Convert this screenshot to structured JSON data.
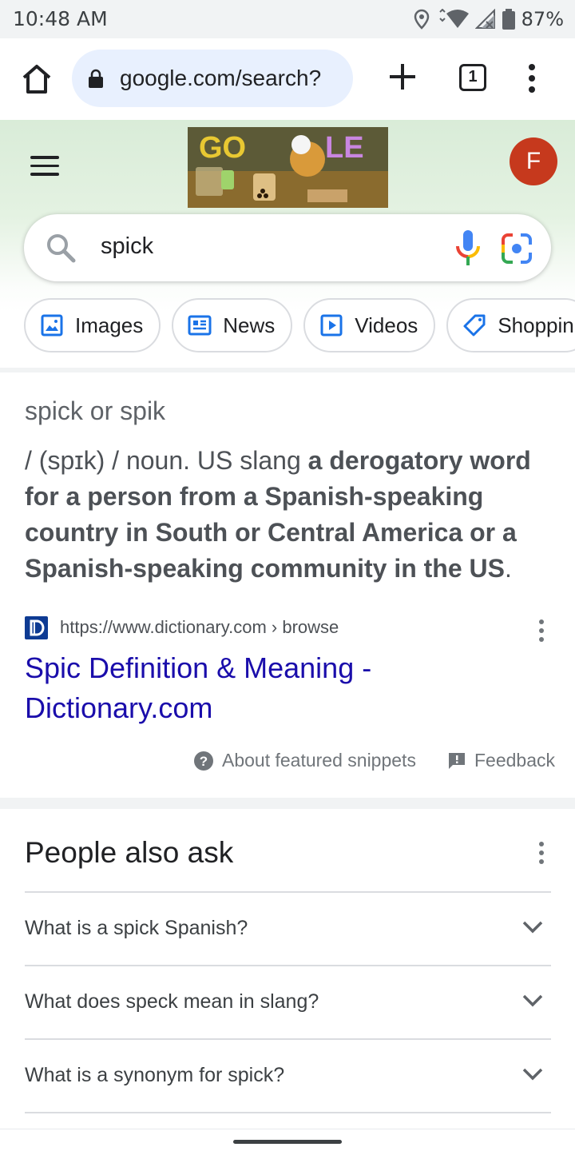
{
  "status_bar": {
    "time": "10:48 AM",
    "battery": "87%"
  },
  "browser": {
    "url": "google.com/search?",
    "tab_count": "1"
  },
  "header": {
    "avatar_letter": "F",
    "doodle_text": "GOOGLE",
    "search_query": "spick"
  },
  "chips": [
    {
      "label": "Images",
      "icon": "image-icon"
    },
    {
      "label": "News",
      "icon": "news-icon"
    },
    {
      "label": "Videos",
      "icon": "video-icon"
    },
    {
      "label": "Shoppin",
      "icon": "tag-icon"
    }
  ],
  "snippet": {
    "word": "spick or spik",
    "def_prefix": "/ (spɪk) / noun. US slang ",
    "def_bold": "a derogatory word for a person from a Spanish-speaking country in South or Central America or a Spanish-speaking community in the US",
    "def_suffix": ".",
    "source_url": "https://www.dictionary.com › browse",
    "source_fav": "D",
    "title": "Spic Definition & Meaning - Dictionary.com",
    "about_label": "About featured snippets",
    "feedback_label": "Feedback"
  },
  "paa": {
    "title": "People also ask",
    "questions": [
      "What is a spick Spanish?",
      "What does speck mean in slang?",
      "What is a synonym for spick?"
    ]
  },
  "colors": {
    "link": "#1a0dab",
    "avatar": "#c6391d",
    "omnibox": "#e8f0fe"
  }
}
